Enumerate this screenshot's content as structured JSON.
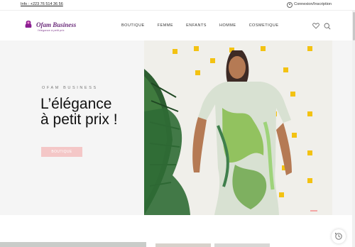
{
  "topbar": {
    "info": "Info : +223 76 514 36 56",
    "login": "Connexion/Inscription"
  },
  "brand": {
    "name": "Ofam Business",
    "tagline": "l'élégance à petit prix",
    "color": "#6a2a7a"
  },
  "nav": [
    "BOUTIQUE",
    "FEMME",
    "ENFANTS",
    "HOMME",
    "COSMETIQUE"
  ],
  "hero": {
    "kicker": "OFAM BUSINESS",
    "headline_line1": "L’élégance",
    "headline_line2": "à petit prix !",
    "cta": "BOUTIQUE",
    "accent": "#f4c7c7"
  },
  "icons": [
    "user-icon",
    "heart-icon",
    "search-icon",
    "history-icon"
  ]
}
